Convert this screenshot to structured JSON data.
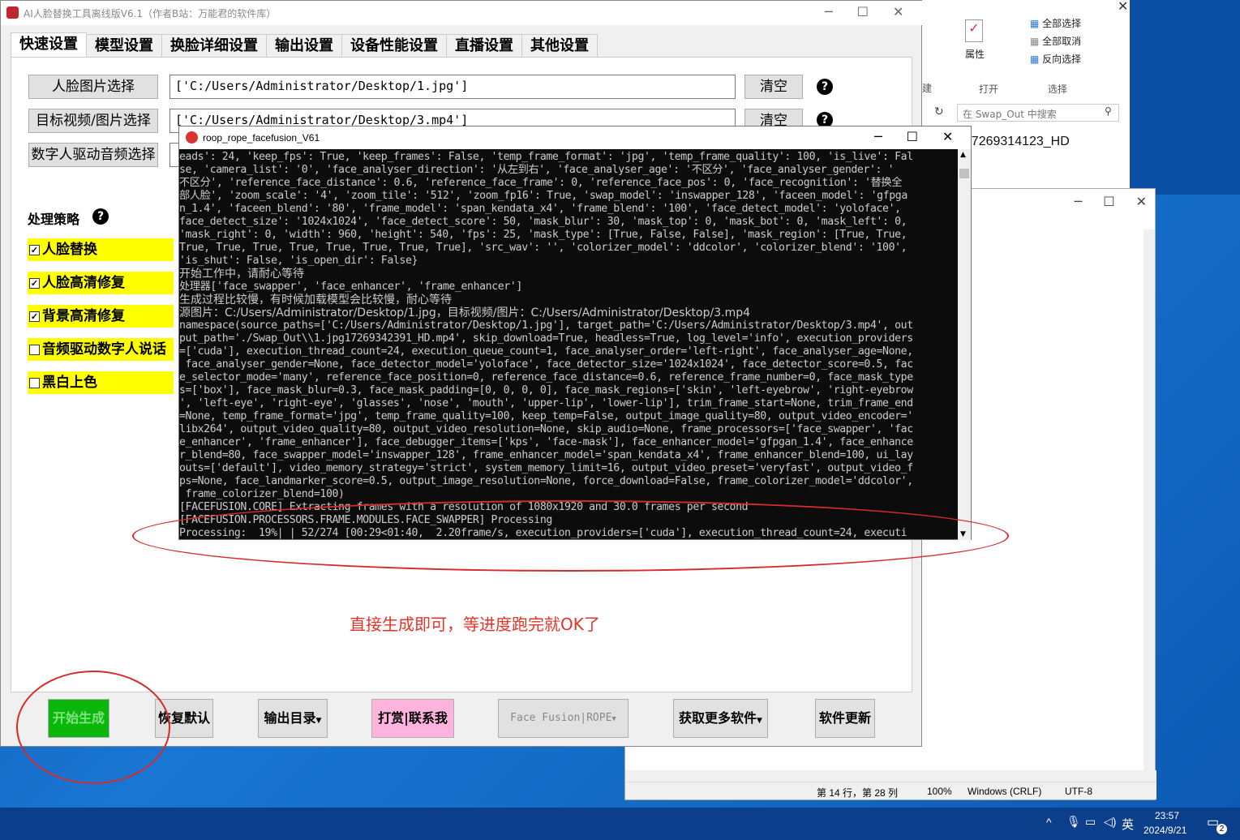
{
  "app": {
    "title": "AI人脸替换工具离线版V6.1（作者B站：万能君的软件库）",
    "tabs": [
      "快速设置",
      "模型设置",
      "换脸详细设置",
      "输出设置",
      "设备性能设置",
      "直播设置",
      "其他设置"
    ],
    "face_select_label": "人脸图片选择",
    "face_path": "['C:/Users/Administrator/Desktop/1.jpg']",
    "target_select_label": "目标视频/图片选择",
    "target_path": "['C:/Users/Administrator/Desktop/3.mp4']",
    "audio_select_label": "数字人驱动音频选择",
    "clear_label": "清空",
    "help_glyph": "?",
    "strategy_label": "处理策略",
    "options": [
      {
        "label": "人脸替换",
        "checked": true,
        "mark": "✓"
      },
      {
        "label": "人脸高清修复",
        "checked": true,
        "mark": "✓"
      },
      {
        "label": "背景高清修复",
        "checked": true,
        "mark": "✓"
      },
      {
        "label": "音频驱动数字人说话",
        "checked": false,
        "mark": ""
      },
      {
        "label": "黑白上色",
        "checked": false,
        "mark": ""
      }
    ],
    "hint": "直接生成即可，等进度跑完就OK了",
    "buttons": {
      "start": "开始生成",
      "reset": "恢复默认",
      "output_dir": "输出目录",
      "donate": "打赏|联系我",
      "engine": "Face Fusion|ROPE",
      "more": "获取更多软件",
      "update": "软件更新"
    },
    "highlight_color": "#ffff00",
    "start_color": "#0cb70c"
  },
  "console": {
    "title": "roop_rope_facefusion_V61",
    "lines": [
      "eads': 24, 'keep_fps': True, 'keep_frames': False, 'temp_frame_format': 'jpg', 'temp_frame_quality': 100, 'is_live': Fal",
      "se, 'camera_list': '0', 'face_analyser_direction': '从左到右', 'face_analyser_age': '不区分', 'face_analyser_gender': '",
      "不区分', 'reference_face_distance': 0.6, 'reference_face_frame': 0, 'reference_face_pos': 0, 'face_recognition': '替换全",
      "部人脸', 'zoom_scale': '4', 'zoom_tile': '512', 'zoom_fp16': True, 'swap_model': 'inswapper_128', 'faceen_model': 'gfpga",
      "n_1.4', 'faceen_blend': '80', 'frame_model': 'span_kendata_x4', 'frame_blend': '100', 'face_detect_model': 'yoloface',",
      "face_detect_size': '1024x1024', 'face_detect_score': 50, 'mask_blur': 30, 'mask_top': 0, 'mask_bot': 0, 'mask_left': 0,",
      "'mask_right': 0, 'width': 960, 'height': 540, 'fps': 25, 'mask_type': [True, False, False], 'mask_region': [True, True,",
      "True, True, True, True, True, True, True, True], 'src_wav': '', 'colorizer_model': 'ddcolor', 'colorizer_blend': '100',",
      "'is_shut': False, 'is_open_dir': False}",
      "开始工作中，请耐心等待",
      "处理器['face_swapper', 'face_enhancer', 'frame_enhancer']",
      "生成过程比较慢，有时候加载模型会比较慢，耐心等待",
      "源图片：C:/Users/Administrator/Desktop/1.jpg，目标视频/图片：C:/Users/Administrator/Desktop/3.mp4",
      "namespace(source_paths=['C:/Users/Administrator/Desktop/1.jpg'], target_path='C:/Users/Administrator/Desktop/3.mp4', out",
      "put_path='./Swap_Out\\\\1.jpg17269342391_HD.mp4', skip_download=True, headless=True, log_level='info', execution_providers",
      "=['cuda'], execution_thread_count=24, execution_queue_count=1, face_analyser_order='left-right', face_analyser_age=None,",
      " face_analyser_gender=None, face_detector_model='yoloface', face_detector_size='1024x1024', face_detector_score=0.5, fac",
      "e_selector_mode='many', reference_face_position=0, reference_face_distance=0.6, reference_frame_number=0, face_mask_type",
      "s=['box'], face_mask_blur=0.3, face_mask_padding=[0, 0, 0, 0], face_mask_regions=['skin', 'left-eyebrow', 'right-eyebrow",
      "', 'left-eye', 'right-eye', 'glasses', 'nose', 'mouth', 'upper-lip', 'lower-lip'], trim_frame_start=None, trim_frame_end",
      "=None, temp_frame_format='jpg', temp_frame_quality=100, keep_temp=False, output_image_quality=80, output_video_encoder='",
      "libx264', output_video_quality=80, output_video_resolution=None, skip_audio=None, frame_processors=['face_swapper', 'fac",
      "e_enhancer', 'frame_enhancer'], face_debugger_items=['kps', 'face-mask'], face_enhancer_model='gfpgan_1.4', face_enhance",
      "r_blend=80, face_swapper_model='inswapper_128', frame_enhancer_model='span_kendata_x4', frame_enhancer_blend=100, ui_lay",
      "outs=['default'], video_memory_strategy='strict', system_memory_limit=16, output_video_preset='veryfast', output_video_f",
      "ps=None, face_landmarker_score=0.5, output_image_resolution=None, force_download=False, frame_colorizer_model='ddcolor',",
      " frame_colorizer_blend=100)",
      "[FACEFUSION.CORE] Extracting frames with a resolution of 1080x1920 and 30.0 frames per second",
      "[FACEFUSION.PROCESSORS.FRAME.MODULES.FACE_SWAPPER] Processing",
      "Processing:  19%| | 52/274 [00:29<01:40,  2.20frame/s, execution_providers=['cuda'], execution_thread_count=24, executi"
    ]
  },
  "explorer": {
    "ribbon_properties": "属性",
    "ribbon_open": "打开",
    "ribbon_select": "选择",
    "select_all": "全部选择",
    "select_none": "全部取消",
    "invert_select": "反向选择",
    "ribbon_partial": "建",
    "search_placeholder": "在 Swap_Out 中搜索",
    "file_name": "g17269314123_HD"
  },
  "notepad": {
    "status_position": "第 14 行，第 28 列",
    "status_zoom": "100%",
    "status_eol": "Windows (CRLF)",
    "status_encoding": "UTF-8"
  },
  "taskbar": {
    "ime": "英",
    "time": "23:57",
    "date": "2024/9/21",
    "notifications": "2"
  }
}
